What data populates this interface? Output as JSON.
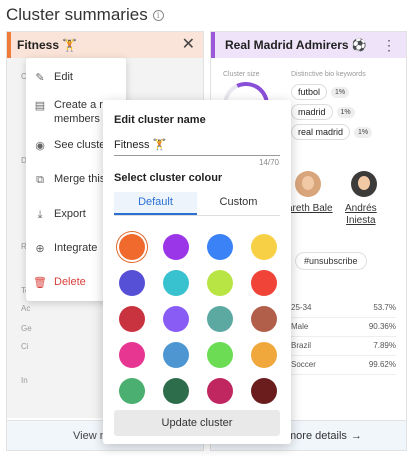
{
  "page": {
    "title": "Cluster summaries"
  },
  "left_card": {
    "name": "Fitness 🏋",
    "footer_label": "View m",
    "faint_labels": [
      "Cl",
      "Di",
      "Re",
      "To",
      "Ac",
      "Ge",
      "Ci",
      "In"
    ]
  },
  "context_menu": {
    "items": [
      {
        "label": "Edit",
        "icon": "pencil-icon"
      },
      {
        "label": "Create a rep\nmembers",
        "icon": "document-icon"
      },
      {
        "label": "See cluster r",
        "icon": "eye-icon"
      },
      {
        "label": "Merge this c",
        "icon": "merge-icon"
      },
      {
        "label": "Export",
        "icon": "download-icon"
      },
      {
        "label": "Integrate",
        "icon": "globe-icon"
      },
      {
        "label": "Delete",
        "icon": "trash-icon"
      }
    ]
  },
  "right_card": {
    "name": "Real Madrid Admirers ⚽",
    "cluster_size_label": "Cluster size",
    "keywords_label": "Distinctive bio keywords",
    "keywords": [
      {
        "word": "futbol",
        "pct": "1%"
      },
      {
        "word": "madrid",
        "pct": "1%"
      },
      {
        "word": "real madrid",
        "pct": "1%"
      }
    ],
    "players": [
      "areth Bale",
      "Andrés\nIniesta"
    ],
    "hashtag": "#unsubscribe",
    "stats": [
      {
        "label": "25-34",
        "value": "53.7%"
      },
      {
        "label": "Male",
        "value": "90.36%"
      },
      {
        "label": "Brazil",
        "value": "7.89%"
      },
      {
        "label": "Soccer",
        "value": "99.62%"
      }
    ],
    "footer_label": "more details",
    "colors": {
      "accent": "#9b59d9"
    }
  },
  "modal": {
    "title": "Edit cluster name",
    "name_value": "Fitness 🏋",
    "counter": "14/70",
    "colour_title": "Select cluster colour",
    "tabs": [
      "Default",
      "Custom"
    ],
    "active_tab": "Default",
    "swatches": [
      "#ef6a2c",
      "#9a35e8",
      "#3b82f6",
      "#f7d046",
      "#5650d6",
      "#38c2cf",
      "#b9e544",
      "#ef4437",
      "#c9323f",
      "#8a5cf6",
      "#5ba9a1",
      "#b15f4b",
      "#e63691",
      "#4d96d2",
      "#6cdc55",
      "#f0a83d",
      "#4aaf70",
      "#2d6d4b",
      "#c02760",
      "#6b1c1c"
    ],
    "selected_swatch": 0,
    "update_label": "Update cluster"
  }
}
